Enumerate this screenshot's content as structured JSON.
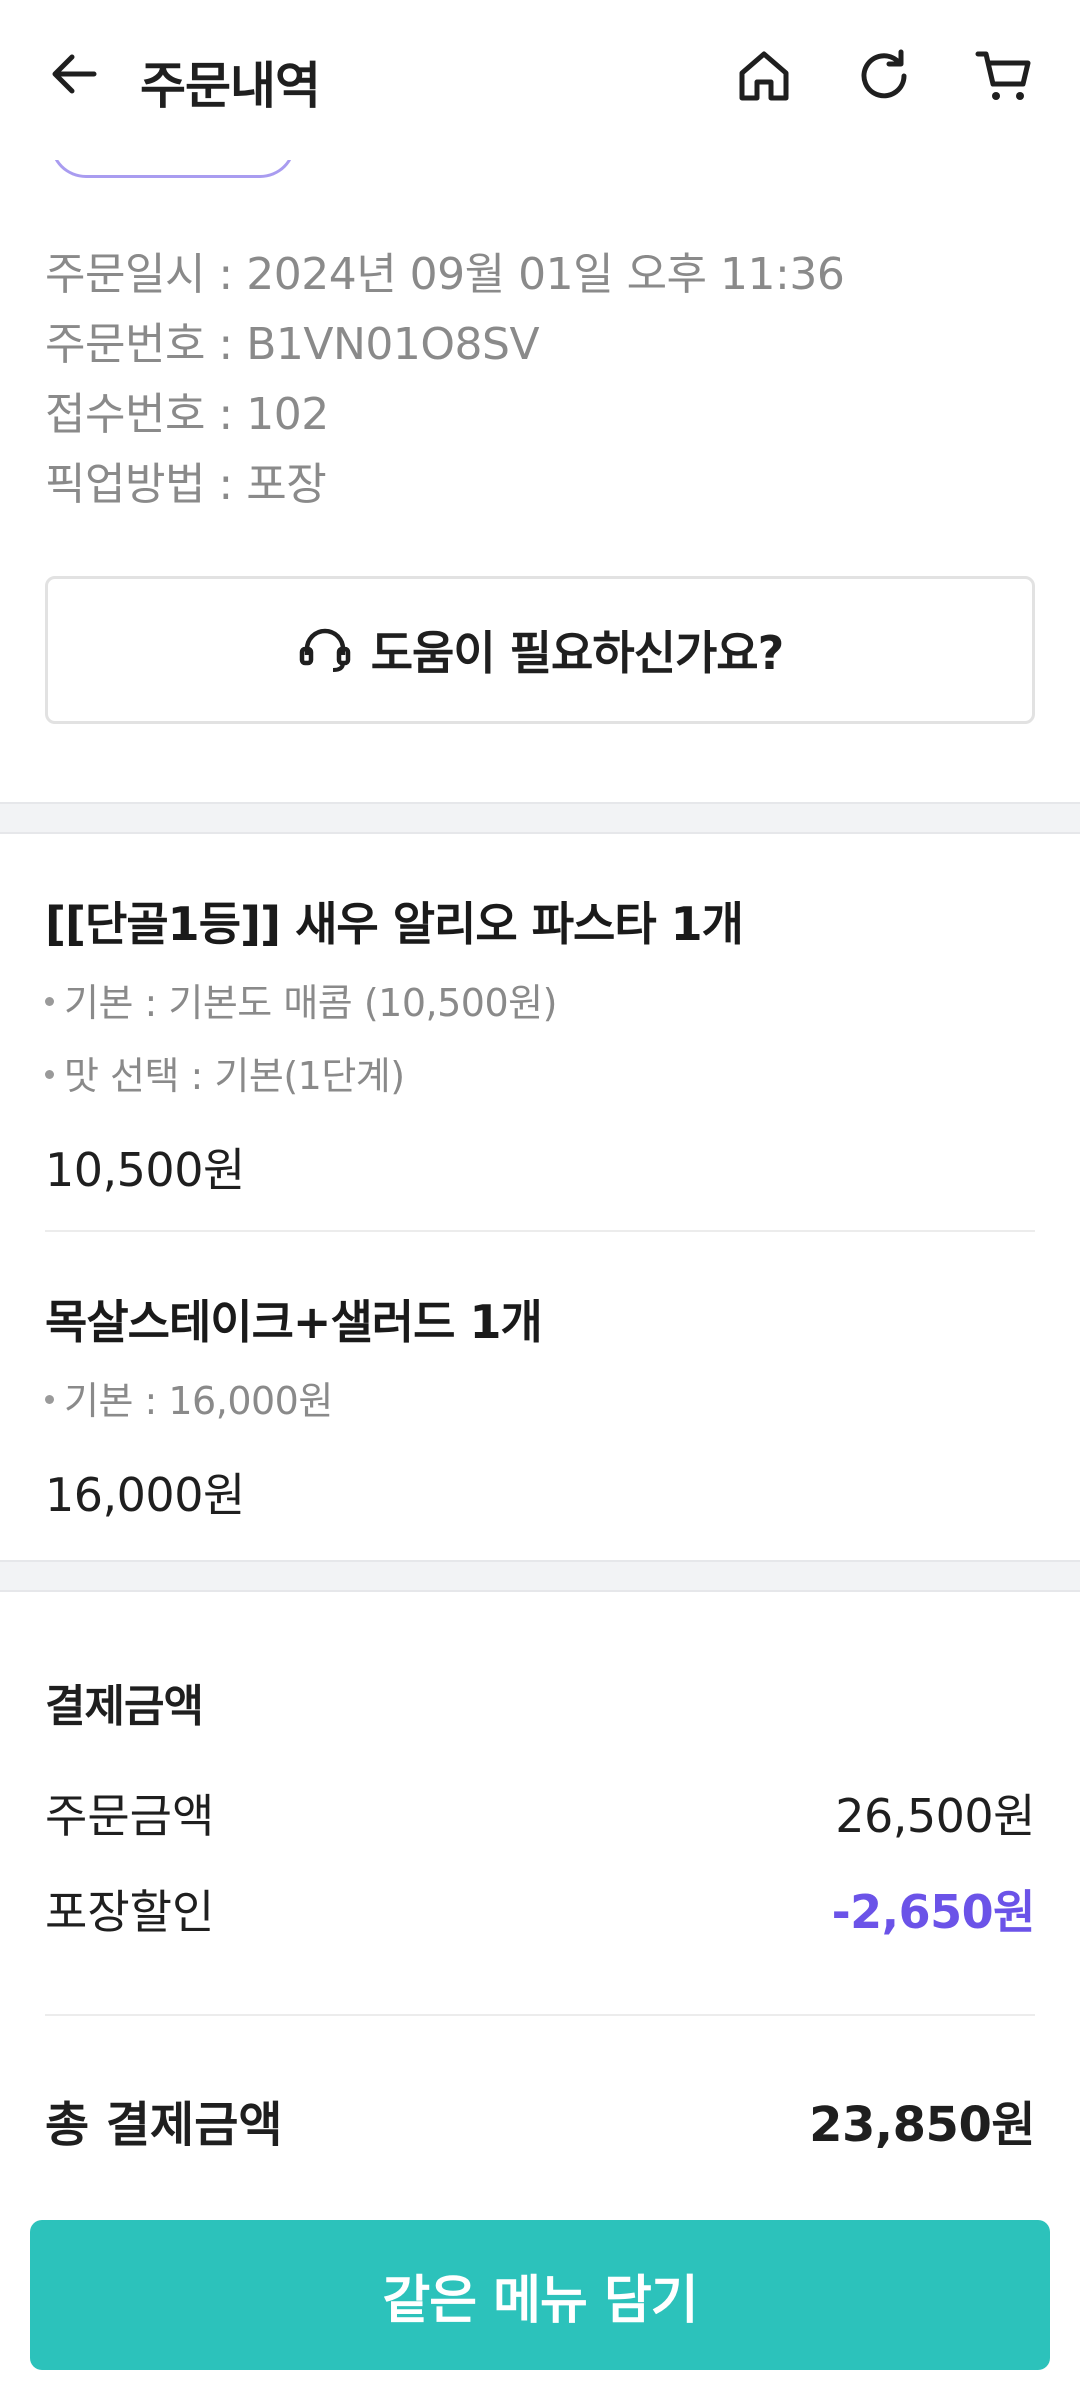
{
  "header": {
    "title": "주문내역",
    "icons": [
      "back-arrow-icon",
      "home-icon",
      "refresh-icon",
      "cart-icon"
    ]
  },
  "order_info": {
    "datetime": "주문일시 : 2024년 09월 01일 오후 11:36",
    "order_number": "주문번호 : B1VN01O8SV",
    "receipt_number": "접수번호 : 102",
    "pickup_method": "픽업방법 : 포장"
  },
  "help": {
    "label": "도움이 필요하신가요?"
  },
  "items": [
    {
      "name": "[[단골1등]] 새우 알리오 파스타 1개",
      "options": [
        "기본 : 기본도 매콤 (10,500원)",
        "맛 선택 : 기본(1단계)"
      ],
      "price": "10,500원"
    },
    {
      "name": "목살스테이크+샐러드 1개",
      "options": [
        "기본 : 16,000원"
      ],
      "price": "16,000원"
    }
  ],
  "payment": {
    "title": "결제금액",
    "order_amount_label": "주문금액",
    "order_amount": "26,500원",
    "discount_label": "포장할인",
    "discount": "-2,650원",
    "total_label": "총 결제금액",
    "total": "23,850원"
  },
  "cta": {
    "label": "같은 메뉴 담기"
  },
  "colors": {
    "accent": "#2cc2bb",
    "discount": "#6b53e8",
    "pill_border": "#a99cf0"
  }
}
